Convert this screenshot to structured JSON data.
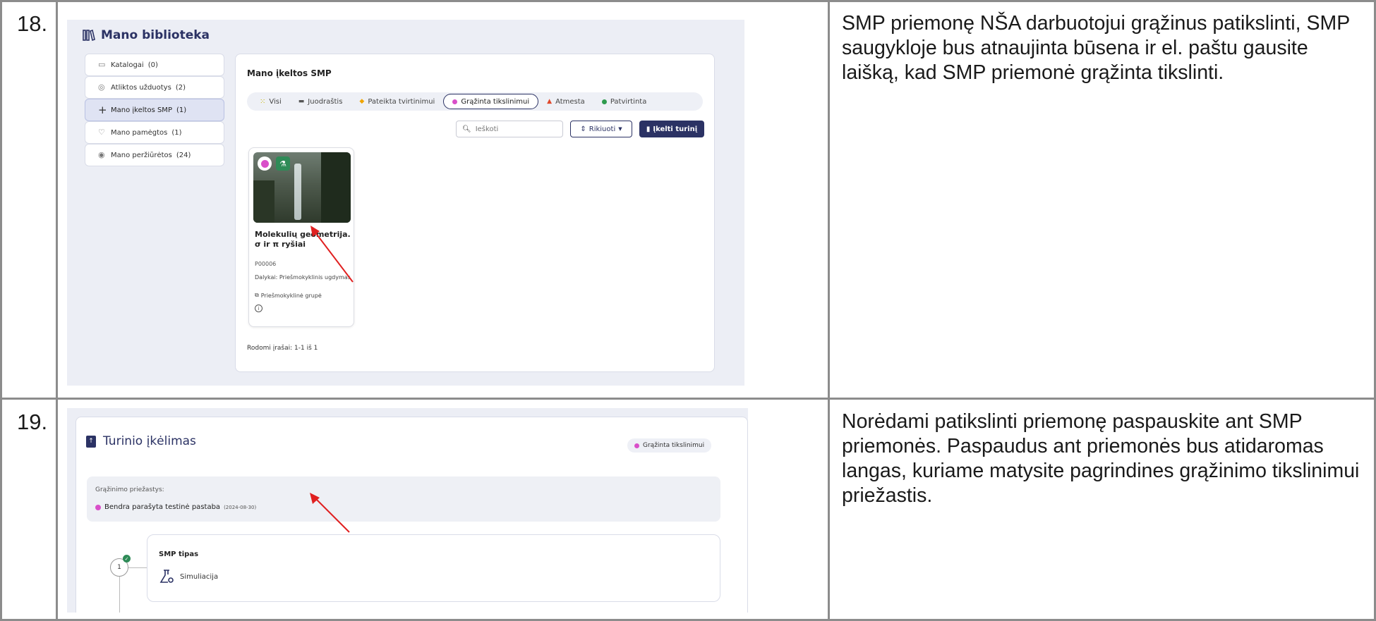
{
  "rows": [
    {
      "number": "18.",
      "description": "SMP priemonę NŠA darbuotojui grąžinus patikslinti, SMP saugykloje bus atnaujinta būsena ir el. paštu gausite laišką, kad SMP priemonė grąžinta tikslinti."
    },
    {
      "number": "19.",
      "description": "Norėdami patikslinti priemonę paspauskite ant SMP priemonės. Paspaudus ant priemonės bus atidaromas langas, kuriame matysite pagrindines grąžinimo tikslinimui priežastis."
    }
  ],
  "library": {
    "title": "Mano biblioteka",
    "sidebar": [
      {
        "label": "Katalogai",
        "count": "(0)",
        "icon": "catalog-icon"
      },
      {
        "label": "Atliktos užduotys",
        "count": "(2)",
        "icon": "check-circle-icon"
      },
      {
        "label": "Mano įkeltos SMP",
        "count": "(1)",
        "icon": "plus-icon"
      },
      {
        "label": "Mano pamėgtos",
        "count": "(1)",
        "icon": "heart-icon"
      },
      {
        "label": "Mano peržiūrėtos",
        "count": "(24)",
        "icon": "eye-icon"
      }
    ],
    "panel_title": "Mano įkeltos SMP",
    "filters": [
      {
        "label": "Visi",
        "color": "#c9b400",
        "active": false
      },
      {
        "label": "Juodraštis",
        "color": "#555555",
        "active": false
      },
      {
        "label": "Pateikta tvirtinimui",
        "color": "#f0a500",
        "active": false
      },
      {
        "label": "Grąžinta tikslinimui",
        "color": "#d94fc9",
        "active": true
      },
      {
        "label": "Atmesta",
        "color": "#e0472b",
        "active": false
      },
      {
        "label": "Patvirtinta",
        "color": "#2e9b4e",
        "active": false
      }
    ],
    "search_placeholder": "Ieškoti",
    "sort_label": "Rikiuoti",
    "upload_label": "Įkelti turinį",
    "card": {
      "title": "Molekulių geometrija. σ ir π ryšiai",
      "code": "P00006",
      "subject": "Dalykai:  Priešmokyklinis ugdymas",
      "group": "Priešmokyklinė grupė"
    },
    "records": "Rodomi įrašai: 1-1 iš 1"
  },
  "upload": {
    "title": "Turinio įkėlimas",
    "status": "Grąžinta tikslinimui",
    "reason_label": "Grąžinimo priežastys:",
    "reason_text": "Bendra parašyta testinė pastaba",
    "reason_date": "(2024-08-30)",
    "type_title": "SMP tipas",
    "type_value": "Simuliacija",
    "step_number": "1"
  },
  "colors": {
    "brand": "#2b3264",
    "returned": "#d94fc9",
    "arrow": "#e02020"
  }
}
